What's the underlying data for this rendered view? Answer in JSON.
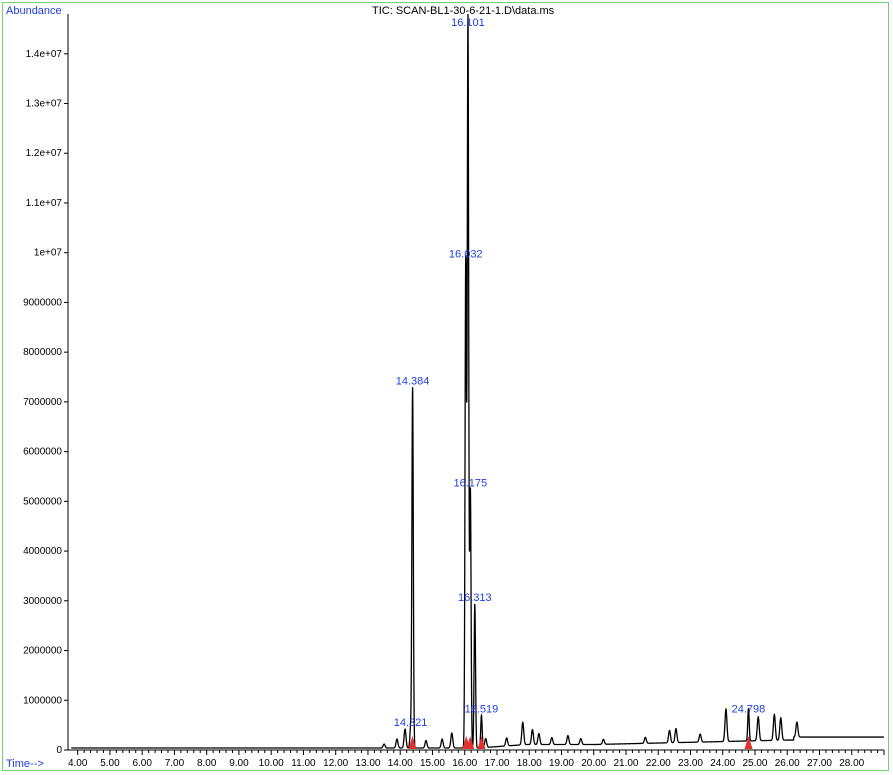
{
  "chart_data": {
    "type": "line",
    "title": "TIC: SCAN-BL1-30-6-21-1.D\\data.ms",
    "ylabel": "Abundance",
    "xlabel": "Time-->",
    "xlim": [
      3.7,
      29.0
    ],
    "ylim": [
      0,
      14800000
    ],
    "x_ticks": [
      "4.00",
      "5.00",
      "6.00",
      "7.00",
      "8.00",
      "9.00",
      "10.00",
      "11.00",
      "12.00",
      "13.00",
      "14.00",
      "15.00",
      "16.00",
      "17.00",
      "18.00",
      "19.00",
      "20.00",
      "21.00",
      "22.00",
      "23.00",
      "24.00",
      "25.00",
      "26.00",
      "27.00",
      "28.00"
    ],
    "y_ticks": [
      {
        "value": 0,
        "label": "0"
      },
      {
        "value": 1000000,
        "label": "1000000"
      },
      {
        "value": 2000000,
        "label": "2000000"
      },
      {
        "value": 3000000,
        "label": "3000000"
      },
      {
        "value": 4000000,
        "label": "4000000"
      },
      {
        "value": 5000000,
        "label": "5000000"
      },
      {
        "value": 6000000,
        "label": "6000000"
      },
      {
        "value": 7000000,
        "label": "7000000"
      },
      {
        "value": 8000000,
        "label": "8000000"
      },
      {
        "value": 9000000,
        "label": "9000000"
      },
      {
        "value": 10000000,
        "label": "1e+07"
      },
      {
        "value": 11000000,
        "label": "1.1e+07"
      },
      {
        "value": 12000000,
        "label": "1.2e+07"
      },
      {
        "value": 13000000,
        "label": "1.3e+07"
      },
      {
        "value": 14000000,
        "label": "1.4e+07"
      }
    ],
    "peaks": [
      {
        "rt": 14.321,
        "label": "14.321",
        "height": 380000
      },
      {
        "rt": 14.384,
        "label": "14.384",
        "height": 7250000
      },
      {
        "rt": 16.032,
        "label": "16.032",
        "height": 9800000
      },
      {
        "rt": 16.101,
        "label": "16.101",
        "height": 14700000
      },
      {
        "rt": 16.175,
        "label": "16.175",
        "height": 5200000
      },
      {
        "rt": 16.313,
        "label": "16.313",
        "height": 2900000
      },
      {
        "rt": 16.519,
        "label": "16.519",
        "height": 650000
      },
      {
        "rt": 24.798,
        "label": "24.798",
        "height": 650000
      }
    ],
    "minor_peaks": [
      {
        "rt": 13.5,
        "height": 80000
      },
      {
        "rt": 13.9,
        "height": 180000
      },
      {
        "rt": 14.15,
        "height": 380000
      },
      {
        "rt": 14.8,
        "height": 150000
      },
      {
        "rt": 15.3,
        "height": 180000
      },
      {
        "rt": 15.6,
        "height": 300000
      },
      {
        "rt": 16.65,
        "height": 180000
      },
      {
        "rt": 17.3,
        "height": 160000
      },
      {
        "rt": 17.8,
        "height": 450000
      },
      {
        "rt": 18.1,
        "height": 300000
      },
      {
        "rt": 18.3,
        "height": 220000
      },
      {
        "rt": 18.7,
        "height": 140000
      },
      {
        "rt": 19.2,
        "height": 180000
      },
      {
        "rt": 19.6,
        "height": 120000
      },
      {
        "rt": 20.3,
        "height": 100000
      },
      {
        "rt": 21.6,
        "height": 120000
      },
      {
        "rt": 22.35,
        "height": 250000
      },
      {
        "rt": 22.55,
        "height": 280000
      },
      {
        "rt": 23.3,
        "height": 160000
      },
      {
        "rt": 24.1,
        "height": 650000
      },
      {
        "rt": 25.1,
        "height": 480000
      },
      {
        "rt": 25.6,
        "height": 520000
      },
      {
        "rt": 25.8,
        "height": 450000
      },
      {
        "rt": 26.3,
        "height": 300000
      }
    ],
    "integration_marks": [
      14.38,
      16.05,
      16.17,
      16.52,
      24.8
    ],
    "colors": {
      "trace": "#000000",
      "axis": "#000000",
      "labels": "#1f3fe0",
      "integration": "#e03030",
      "frame": "#6fd36f"
    }
  }
}
